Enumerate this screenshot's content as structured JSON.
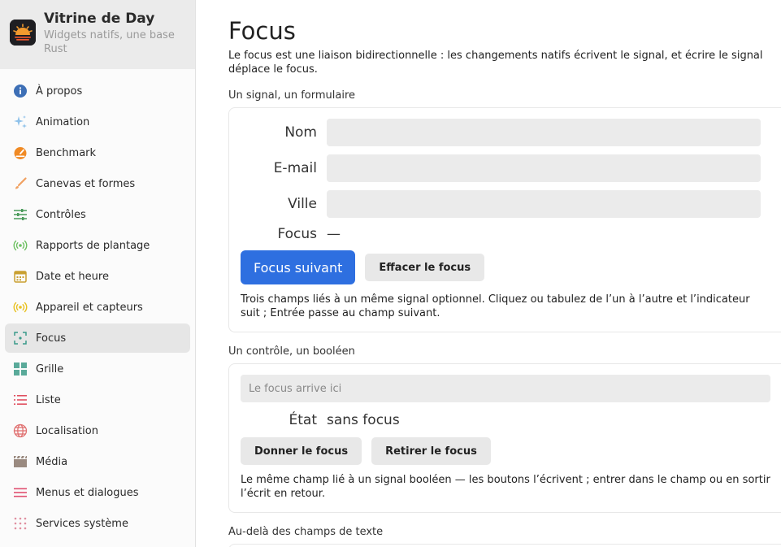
{
  "app": {
    "title": "Vitrine de Day",
    "subtitle": "Widgets natifs, une base Rust"
  },
  "sidebar": {
    "items": [
      {
        "label": "À propos",
        "icon": "info-icon",
        "color": "#3d6fb6"
      },
      {
        "label": "Animation",
        "icon": "sparkles-icon",
        "color": "#8ec1ea"
      },
      {
        "label": "Benchmark",
        "icon": "gauge-icon",
        "color": "#f08a24"
      },
      {
        "label": "Canevas et formes",
        "icon": "brush-icon",
        "color": "#f0a060"
      },
      {
        "label": "Contrôles",
        "icon": "sliders-icon",
        "color": "#4a9a5a"
      },
      {
        "label": "Rapports de plantage",
        "icon": "broadcast-icon",
        "color": "#6cc060"
      },
      {
        "label": "Date et heure",
        "icon": "calendar-icon",
        "color": "#c9a030"
      },
      {
        "label": "Appareil et capteurs",
        "icon": "sensor-icon",
        "color": "#e8c020"
      },
      {
        "label": "Focus",
        "icon": "focus-icon",
        "color": "#3a9a8a"
      },
      {
        "label": "Grille",
        "icon": "grid-icon",
        "color": "#5aaa9a"
      },
      {
        "label": "Liste",
        "icon": "list-icon",
        "color": "#e05060"
      },
      {
        "label": "Localisation",
        "icon": "globe-icon",
        "color": "#e07070"
      },
      {
        "label": "Média",
        "icon": "clapper-icon",
        "color": "#9a8a80"
      },
      {
        "label": "Menus et dialogues",
        "icon": "menu-icon",
        "color": "#e05070"
      },
      {
        "label": "Services système",
        "icon": "dots-grid-icon",
        "color": "#e090a0"
      }
    ],
    "selected_index": 8
  },
  "main": {
    "title": "Focus",
    "description": "Le focus est une liaison bidirectionnelle : les changements natifs écrivent le signal, et écrire le signal déplace le focus.",
    "section1": {
      "label": "Un signal, un formulaire",
      "fields": [
        {
          "label": "Nom",
          "value": ""
        },
        {
          "label": "E-mail",
          "value": ""
        },
        {
          "label": "Ville",
          "value": ""
        }
      ],
      "focus_label": "Focus",
      "focus_value": "—",
      "primary_button": "Focus suivant",
      "secondary_button": "Effacer le focus",
      "note": "Trois champs liés à un même signal optionnel. Cliquez ou tabulez de l’un à l’autre et l’indicateur suit ; Entrée passe au champ suivant."
    },
    "section2": {
      "label": "Un contrôle, un booléen",
      "input_placeholder": "Le focus arrive ici",
      "state_label": "État",
      "state_value": "sans focus",
      "give_button": "Donner le focus",
      "remove_button": "Retirer le focus",
      "note": "Le même champ lié à un signal booléen — les boutons l’écrivent ; entrer dans le champ ou en sortir l’écrit en retour."
    },
    "section3": {
      "label": "Au-delà des champs de texte"
    }
  }
}
